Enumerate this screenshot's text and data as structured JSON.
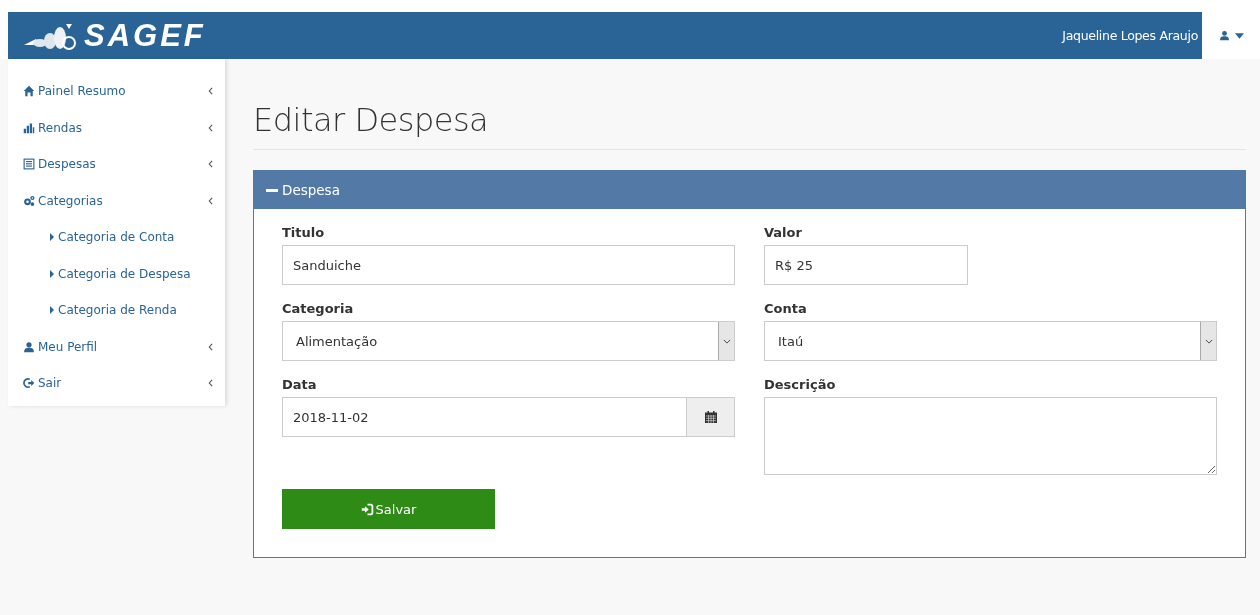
{
  "topbar": {
    "brand": "SAGEF",
    "user_name": "Jaqueline Lopes Araujo"
  },
  "sidebar": {
    "items": [
      {
        "label": "Painel Resumo"
      },
      {
        "label": "Rendas"
      },
      {
        "label": "Despesas"
      },
      {
        "label": "Categorias",
        "children": [
          {
            "label": "Categoria de Conta"
          },
          {
            "label": "Categoria de Despesa"
          },
          {
            "label": "Categoria de Renda"
          }
        ]
      },
      {
        "label": "Meu Perfil"
      },
      {
        "label": "Sair"
      }
    ]
  },
  "page_title": "Editar Despesa",
  "panel": {
    "title": "Despesa",
    "fields": [
      {
        "kind": "text",
        "label": "Titulo",
        "value": "Sanduiche"
      },
      {
        "kind": "money",
        "label": "Valor",
        "value": "R$ 25"
      },
      {
        "kind": "select",
        "label": "Categoria",
        "value": "Alimentação"
      },
      {
        "kind": "select",
        "label": "Conta",
        "value": "Itaú"
      },
      {
        "kind": "date",
        "label": "Data",
        "value": "2018-11-02"
      },
      {
        "kind": "textarea",
        "label": "Descrição"
      }
    ],
    "submit": "Salvar"
  }
}
